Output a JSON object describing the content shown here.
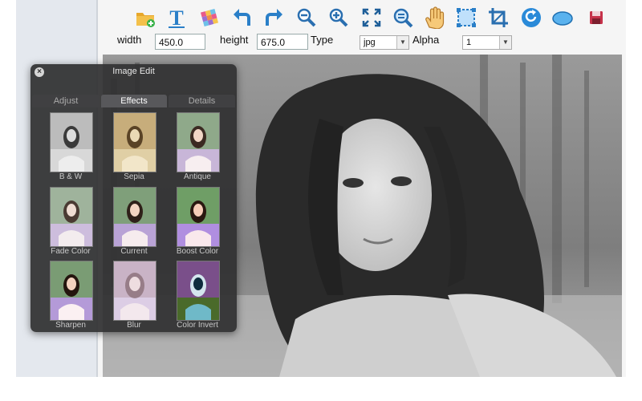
{
  "toolbar": {
    "icons": [
      "open-folder-icon",
      "text-tool-icon",
      "mosaic-icon",
      "undo-icon",
      "redo-icon",
      "zoom-out-icon",
      "zoom-in-icon",
      "fit-screen-icon",
      "zoom-actual-icon",
      "hand-pan-icon",
      "select-rect-icon",
      "crop-icon",
      "rotate-icon",
      "ellipse-icon",
      "save-disk-icon"
    ]
  },
  "props": {
    "width_label": "width",
    "width_value": "450.0",
    "height_label": "height",
    "height_value": "675.0",
    "type_label": "Type",
    "type_value": "jpg",
    "alpha_label": "Alpha",
    "alpha_value": "1"
  },
  "palette": {
    "title": "Image Edit",
    "tabs": [
      "Adjust",
      "Effects",
      "Details"
    ],
    "active_tab": "Effects",
    "effects": [
      "B & W",
      "Sepia",
      "Antique",
      "Fade Color",
      "Current",
      "Boost Color",
      "Sharpen",
      "Blur",
      "Color Invert"
    ]
  }
}
